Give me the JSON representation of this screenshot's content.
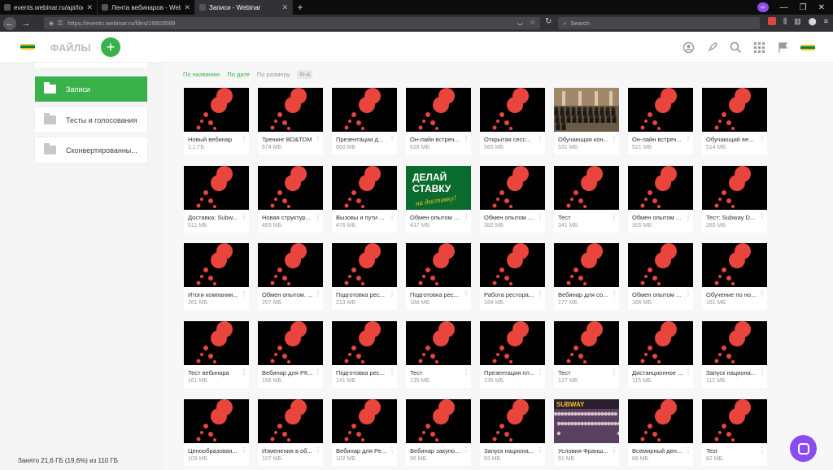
{
  "browser": {
    "tabs": [
      {
        "title": "events.webinar.ru/api/login?sessio",
        "active": false
      },
      {
        "title": "Лента вебинаров - Webinar",
        "active": false
      },
      {
        "title": "Записи - Webinar",
        "active": true
      }
    ],
    "url": "https://events.webinar.ru/files/19903589",
    "search_placeholder": "Search"
  },
  "header": {
    "title": "ФАЙЛЫ",
    "add_label": "+"
  },
  "sidebar": {
    "items": [
      {
        "label": "Записи",
        "active": true
      },
      {
        "label": "Тесты и голосования",
        "active": false
      },
      {
        "label": "Сконвертированны...",
        "active": false
      }
    ],
    "storage": "Занято 21,6 ГБ (19,6%) из 110 ГБ"
  },
  "sort": {
    "by_name": "По названию",
    "by_date": "По дате",
    "by_size": "По размеру",
    "order": "Я-А"
  },
  "files": [
    {
      "name": "Новый вебинар",
      "size": "1,1 ГБ",
      "thumb": "red"
    },
    {
      "name": "Тренинг BD&TDM",
      "size": "674 МБ",
      "thumb": "red"
    },
    {
      "name": "Презентации д...",
      "size": "660 МБ",
      "thumb": "red"
    },
    {
      "name": "Он-лайн встреч...",
      "size": "628 МБ",
      "thumb": "red"
    },
    {
      "name": "Открытая сесс...",
      "size": "585 МБ",
      "thumb": "red"
    },
    {
      "name": "Обучающая кон...",
      "size": "531 МБ",
      "thumb": "photo-hall"
    },
    {
      "name": "Он-лайн встреч...",
      "size": "521 МБ",
      "thumb": "red"
    },
    {
      "name": "Обучающий ве...",
      "size": "514 МБ",
      "thumb": "red"
    },
    {
      "name": "Доставка: Subw...",
      "size": "511 МБ",
      "thumb": "red"
    },
    {
      "name": "Новая структур...",
      "size": "483 МБ",
      "thumb": "red"
    },
    {
      "name": "Вызовы и пути ...",
      "size": "476 МБ",
      "thumb": "red"
    },
    {
      "name": "Обмен опытом ...",
      "size": "437 МБ",
      "thumb": "promo"
    },
    {
      "name": "Обмен опытом ...",
      "size": "382 МБ",
      "thumb": "red"
    },
    {
      "name": "Тест",
      "size": "341 МБ",
      "thumb": "red"
    },
    {
      "name": "Обмен опытом ...",
      "size": "305 МБ",
      "thumb": "red"
    },
    {
      "name": "Тест: Subway D...",
      "size": "285 МБ",
      "thumb": "red"
    },
    {
      "name": "Итоги компании...",
      "size": "261 МБ",
      "thumb": "red"
    },
    {
      "name": "Обмен опытом. ...",
      "size": "257 МБ",
      "thumb": "red"
    },
    {
      "name": "Подготовка рес...",
      "size": "213 МБ",
      "thumb": "red"
    },
    {
      "name": "Подготовка рес...",
      "size": "188 МБ",
      "thumb": "red"
    },
    {
      "name": "Работа ресторa...",
      "size": "184 МБ",
      "thumb": "red"
    },
    {
      "name": "Вебинар для со...",
      "size": "177 МБ",
      "thumb": "red"
    },
    {
      "name": "Обмен опытом ...",
      "size": "166 МБ",
      "thumb": "red"
    },
    {
      "name": "Обучение по но...",
      "size": "161 МБ",
      "thumb": "red"
    },
    {
      "name": "Тест вебинара",
      "size": "161 МБ",
      "thumb": "red"
    },
    {
      "name": "Вебинар для РК...",
      "size": "156 МБ",
      "thumb": "red"
    },
    {
      "name": "Подготовка рес...",
      "size": "141 МБ",
      "thumb": "red"
    },
    {
      "name": "Тест",
      "size": "135 МБ",
      "thumb": "red"
    },
    {
      "name": "Презентация пл...",
      "size": "135 МБ",
      "thumb": "red"
    },
    {
      "name": "Тест",
      "size": "127 МБ",
      "thumb": "red"
    },
    {
      "name": "Дистанционное ...",
      "size": "115 МБ",
      "thumb": "red"
    },
    {
      "name": "Запуск национа...",
      "size": "112 МБ",
      "thumb": "red"
    },
    {
      "name": "Ценообразован...",
      "size": "109 МБ",
      "thumb": "red"
    },
    {
      "name": "Изменения в об...",
      "size": "107 МБ",
      "thumb": "red"
    },
    {
      "name": "Вебинар для Ре...",
      "size": "102 МБ",
      "thumb": "red"
    },
    {
      "name": "Вебинар закупо...",
      "size": "96 МБ",
      "thumb": "red"
    },
    {
      "name": "Запуск национа...",
      "size": "93 МБ",
      "thumb": "red"
    },
    {
      "name": "Условия Франш...",
      "size": "91 МБ",
      "thumb": "photo-crowd"
    },
    {
      "name": "Всемирный ден...",
      "size": "88 МБ",
      "thumb": "red"
    },
    {
      "name": "Test",
      "size": "82 МБ",
      "thumb": "red"
    }
  ],
  "promo_text": {
    "line1": "ДЕЛАЙ",
    "line2": "СТАВКУ",
    "line3": "на доставку!"
  },
  "crowd_logo": "SUBWAY",
  "colors": {
    "accent": "#3ab14a",
    "thumb_red": "#e9453d",
    "chat": "#8a4cf0"
  }
}
